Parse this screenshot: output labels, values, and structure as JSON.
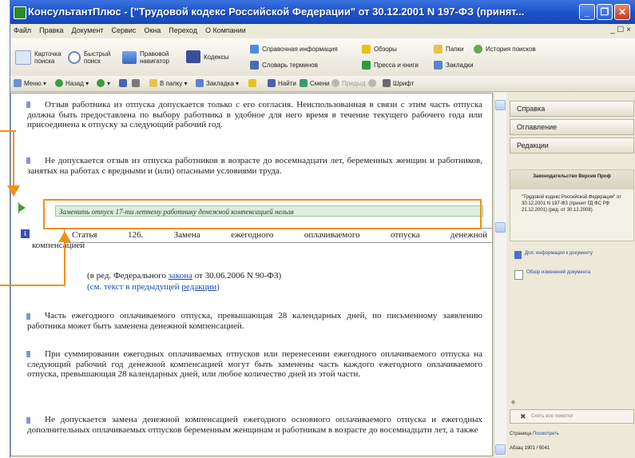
{
  "window": {
    "title": "КонсультантПлюс - [\"Трудовой кодекс Российской Федерации\" от 30.12.2001 N 197-ФЗ (принят...",
    "minimize": "_",
    "restore": "❐",
    "close": "✕"
  },
  "menu": {
    "items": [
      "Файл",
      "Правка",
      "Документ",
      "Сервис",
      "Окна",
      "Переход",
      "О Компании"
    ],
    "right_controls": "_ ☐ ×"
  },
  "toolbar1": {
    "big": [
      {
        "label": "Карточка поиска",
        "icon": "search-card-icon"
      },
      {
        "label": "Быстрый поиск",
        "icon": "quick-search-icon"
      },
      {
        "label": "Правовой навигатор",
        "icon": "legal-navigator-icon"
      },
      {
        "label": "Кодексы",
        "icon": "codes-icon"
      }
    ],
    "small": [
      {
        "label": "Справочная информация",
        "icon": "reference-info-icon"
      },
      {
        "label": "Обзоры",
        "icon": "reviews-icon"
      },
      {
        "label": "Словарь терминов",
        "icon": "dictionary-icon"
      },
      {
        "label": "Пресса и книги",
        "icon": "press-books-icon"
      },
      {
        "label": "Папки",
        "icon": "folders-icon"
      },
      {
        "label": "История поисков",
        "icon": "search-history-icon"
      },
      {
        "label": "Закладки",
        "icon": "bookmarks-icon"
      }
    ]
  },
  "toolbar2": {
    "items": [
      {
        "label": "Меню ▾",
        "icon": "menu-icon"
      },
      {
        "label": "Назад ▾",
        "icon": "back-icon"
      },
      {
        "label": "▾",
        "icon": "forward-icon"
      },
      {
        "label": "",
        "icon": "save-icon"
      },
      {
        "label": "",
        "icon": "print-icon"
      },
      {
        "label": "В папку ▾",
        "icon": "to-folder-icon"
      },
      {
        "label": "Закладка ▾",
        "icon": "bookmark-icon"
      },
      {
        "label": "",
        "icon": "highlight-icon"
      },
      {
        "label": "Найти",
        "icon": "find-icon"
      },
      {
        "label": "Смени",
        "icon": "change-icon"
      },
      {
        "label": "Предыд",
        "icon": "prev-icon"
      },
      {
        "label": "",
        "icon": "next-icon"
      },
      {
        "label": "Шрифт",
        "icon": "font-icon"
      }
    ]
  },
  "document": {
    "para1": "Отзыв работника из отпуска допускается только с его согласия. Неиспользованная в связи с этим часть отпуска должна быть предоставлена по выбору работника в удобное для него время в течение текущего рабочего года или присоединена к отпуску за следующий рабочий год.",
    "para2": "Не допускается отзыв из отпуска работников в возрасте до восемнадцати лет, беременных женщин и работников, занятых на работах с вредными и (или) опасными условиями труда.",
    "comment": "Заменить отпуск 17-ти летнему работнику денежной компенсацией нельзя",
    "article_title_line1": "Статья 126. Замена ежегодного оплачиваемого отпуска денежной",
    "article_title_line2": "компенсацией",
    "info_icon_letter": "i",
    "redaction_prefix": "(в ред. Федерального",
    "redaction_link": "закона",
    "redaction_suffix": "от 30.06.2006 N 90-ФЗ)",
    "prev_text_prefix": "(см. текст в предыдущей",
    "prev_text_link": "редакции",
    "prev_text_suffix": ")",
    "para3": "Часть ежегодного оплачиваемого отпуска, превышающая 28 календарных дней, по письменному заявлению работника может быть заменена денежной компенсацией.",
    "para4": "При суммировании ежегодных оплачиваемых отпусков или перенесении ежегодного оплачиваемого отпуска на следующий рабочий год денежной компенсацией могут быть заменены часть каждого ежегодного оплачиваемого отпуска, превышающая 28 календарных дней, или любое количество дней из этой части.",
    "para5": "Не допускается замена денежной компенсацией ежегодного основного оплачиваемого отпуска и ежегодных дополнительных оплачиваемых отпусков беременным женщинам и работникам в возрасте до восемнадцати лет, а также"
  },
  "sidebar": {
    "tabs": [
      "Справка",
      "Оглавление",
      "Редакции"
    ],
    "panel_head": "Законодательство Версия Проф",
    "panel_body": "\"Трудовой кодекс Российской Федерации\" от 30.12.2001 N 197-ФЗ (принят ГД ФС РФ 21.12.2001) (ред. от 30.12.2008)",
    "link1": "Доп. информация к документу",
    "link2": "Обзор изменений документа",
    "bottom_button": "Снять все пометки",
    "status_left": "Страница",
    "status_link": "Посмотреть",
    "abzac": "Абзац 1901 / 5041"
  }
}
